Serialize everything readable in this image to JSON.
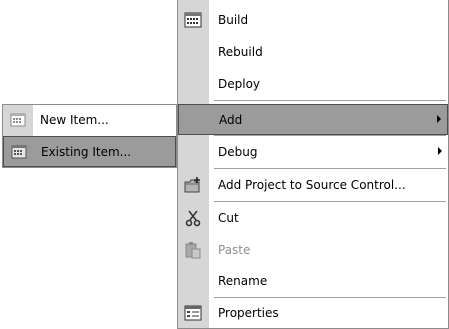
{
  "context_menu": {
    "items": [
      {
        "label": "Build",
        "icon": "build-icon"
      },
      {
        "label": "Rebuild"
      },
      {
        "label": "Deploy"
      },
      {
        "label": "Add",
        "highlighted": true,
        "has_submenu": true
      },
      {
        "label": "Debug",
        "has_submenu": true
      },
      {
        "label": "Add Project to Source Control...",
        "icon": "folder-add-icon"
      },
      {
        "label": "Cut",
        "icon": "scissors-icon"
      },
      {
        "label": "Paste",
        "icon": "paste-icon",
        "disabled": true
      },
      {
        "label": "Rename"
      },
      {
        "label": "Properties",
        "icon": "properties-icon"
      }
    ]
  },
  "add_submenu": {
    "items": [
      {
        "label": "New Item...",
        "icon": "new-item-icon"
      },
      {
        "label": "Existing Item...",
        "icon": "existing-item-icon",
        "highlighted": true
      }
    ]
  },
  "colors": {
    "highlight": "#9b9b9b",
    "gutter": "#d6d6d6",
    "disabled_text": "#8f8f8f"
  }
}
